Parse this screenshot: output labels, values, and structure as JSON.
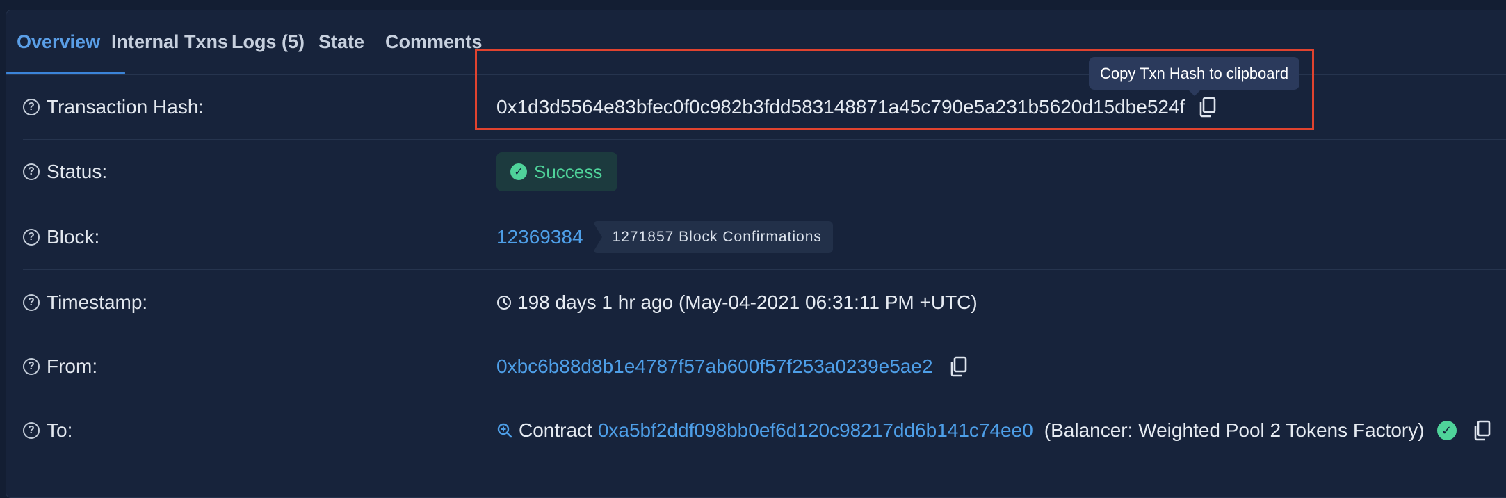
{
  "tabs": {
    "overview": "Overview",
    "internal_txns": "Internal Txns",
    "logs": "Logs (5)",
    "state": "State",
    "comments": "Comments"
  },
  "tooltip": "Copy Txn Hash to clipboard",
  "rows": {
    "hash": {
      "label": "Transaction Hash:",
      "value": "0x1d3d5564e83bfec0f0c982b3fdd583148871a45c790e5a231b5620d15dbe524f"
    },
    "status": {
      "label": "Status:",
      "value": "Success"
    },
    "block": {
      "label": "Block:",
      "value": "12369384",
      "confirmations": "1271857 Block Confirmations"
    },
    "timestamp": {
      "label": "Timestamp:",
      "value": "198 days 1 hr ago (May-04-2021 06:31:11 PM +UTC)"
    },
    "from": {
      "label": "From:",
      "value": "0xbc6b88d8b1e4787f57ab600f57f253a0239e5ae2"
    },
    "to": {
      "label": "To:",
      "prefix": "Contract",
      "address": "0xa5bf2ddf098bb0ef6d120c98217dd6b141c74ee0",
      "name": "(Balancer: Weighted Pool 2 Tokens Factory)"
    }
  },
  "icons": {
    "help": "question-circle-icon",
    "copy": "copy-icon",
    "success": "check-circle-icon",
    "clock": "clock-icon",
    "contract": "zoom-in-icon",
    "verified": "verified-check-icon"
  },
  "colors": {
    "background": "#131e33",
    "card": "#17233b",
    "link": "#4e9fe8",
    "active_tab": "#5a9ee6",
    "success": "#4fd39a",
    "highlight": "#e0432f",
    "tooltip": "#2b3a5c"
  }
}
